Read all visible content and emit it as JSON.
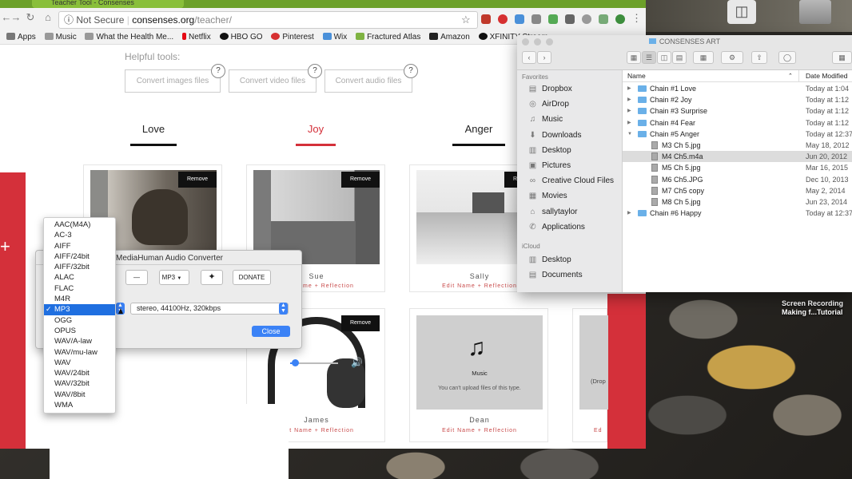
{
  "browser": {
    "tab_title": "Teacher Tool - Consenses",
    "security_label": "Not Secure",
    "url_domain": "consenses.org",
    "url_path": "/teacher/",
    "bookmarks": [
      "Apps",
      "Music",
      "What the Health Me...",
      "Netflix",
      "HBO GO",
      "Pinterest",
      "Wix",
      "Fractured Atlas",
      "Amazon",
      "XFINITY Stream"
    ]
  },
  "page": {
    "helpful_tools": "Helpful tools:",
    "tools": [
      "Convert images files",
      "Convert video files",
      "Convert audio files"
    ],
    "question_mark": "?",
    "chain_tabs": [
      {
        "label": "Love",
        "color": "#222222"
      },
      {
        "label": "Joy",
        "color": "#d4303a"
      },
      {
        "label": "Anger",
        "color": "#222222"
      }
    ],
    "remove_label": "Remove",
    "edit_label": "Edit Name + Reflection",
    "cards": {
      "card2_name": "Sue",
      "card3_name": "Sally",
      "card4_name": "James",
      "card5_name": "Dean"
    },
    "music_label": "Music",
    "music_notice": "You can't upload files of this type.",
    "drop_partial": "(Drop",
    "plus": "+"
  },
  "converter": {
    "title": "MediaHuman Audio Converter",
    "format": "MP3",
    "donate": "DONATE",
    "quality": "stereo, 44100Hz, 320kbps",
    "close": "Close",
    "minus": "—"
  },
  "format_menu": {
    "items": [
      "AAC(M4A)",
      "AC-3",
      "AIFF",
      "AIFF/24bit",
      "AIFF/32bit",
      "ALAC",
      "FLAC",
      "M4R",
      "MP3",
      "OGG",
      "OPUS",
      "WAV/A-law",
      "WAV/mu-law",
      "WAV",
      "WAV/24bit",
      "WAV/32bit",
      "WAV/8bit",
      "WMA"
    ],
    "selected": "MP3",
    "checkmark": "✓"
  },
  "finder": {
    "title": "CONSENSES ART",
    "favorites_heading": "Favorites",
    "favorites": [
      {
        "label": "Dropbox",
        "icon": "dropbox-icon",
        "glyph": "▤"
      },
      {
        "label": "AirDrop",
        "icon": "airdrop-icon",
        "glyph": "◎"
      },
      {
        "label": "Music",
        "icon": "music-icon",
        "glyph": "♫"
      },
      {
        "label": "Downloads",
        "icon": "downloads-icon",
        "glyph": "⬇"
      },
      {
        "label": "Desktop",
        "icon": "desktop-icon",
        "glyph": "▥"
      },
      {
        "label": "Pictures",
        "icon": "pictures-icon",
        "glyph": "▣"
      },
      {
        "label": "Creative Cloud Files",
        "icon": "creative-cloud-icon",
        "glyph": "∞"
      },
      {
        "label": "Movies",
        "icon": "movies-icon",
        "glyph": "▦"
      },
      {
        "label": "sallytaylor",
        "icon": "home-icon",
        "glyph": "⌂"
      },
      {
        "label": "Applications",
        "icon": "applications-icon",
        "glyph": "✆"
      }
    ],
    "icloud_heading": "iCloud",
    "icloud": [
      {
        "label": "Desktop",
        "icon": "icloud-desktop-icon",
        "glyph": "▥"
      },
      {
        "label": "Documents",
        "icon": "documents-icon",
        "glyph": "▤"
      }
    ],
    "col_name": "Name",
    "col_date": "Date Modified",
    "rows": [
      {
        "name": "Chain #1 Love",
        "date": "Today at 1:04",
        "type": "folder",
        "level": 0,
        "tri": "▶"
      },
      {
        "name": "Chain #2 Joy",
        "date": "Today at 1:12",
        "type": "folder",
        "level": 0,
        "tri": "▶"
      },
      {
        "name": "Chain #3 Surprise",
        "date": "Today at 1:12",
        "type": "folder",
        "level": 0,
        "tri": "▶"
      },
      {
        "name": "Chain #4 Fear",
        "date": "Today at 1:12",
        "type": "folder",
        "level": 0,
        "tri": "▶"
      },
      {
        "name": "Chain #5 Anger",
        "date": "Today at 12:37",
        "type": "folder",
        "level": 0,
        "tri": "▼"
      },
      {
        "name": "M3 Ch 5.jpg",
        "date": "May 18, 2012",
        "type": "file",
        "level": 1,
        "tri": ""
      },
      {
        "name": "M4 Ch5.m4a",
        "date": "Jun 20, 2012",
        "type": "file",
        "level": 1,
        "tri": "",
        "selected": true
      },
      {
        "name": "M5 Ch 5.jpg",
        "date": "Mar 16, 2015",
        "type": "file",
        "level": 1,
        "tri": ""
      },
      {
        "name": "M6 Ch5.JPG",
        "date": "Dec 10, 2013",
        "type": "file",
        "level": 1,
        "tri": ""
      },
      {
        "name": "M7 Ch5 copy",
        "date": "May 2, 2014",
        "type": "file",
        "level": 1,
        "tri": ""
      },
      {
        "name": "M8 Ch 5.jpg",
        "date": "Jun 23, 2014",
        "type": "file",
        "level": 1,
        "tri": ""
      },
      {
        "name": "Chain #6 Happy",
        "date": "Today at 12:37",
        "type": "folder",
        "level": 0,
        "tri": "▶"
      }
    ]
  },
  "desktop": {
    "recording_line1": "Screen Recording",
    "recording_line2": "Making f...Tutorial"
  }
}
